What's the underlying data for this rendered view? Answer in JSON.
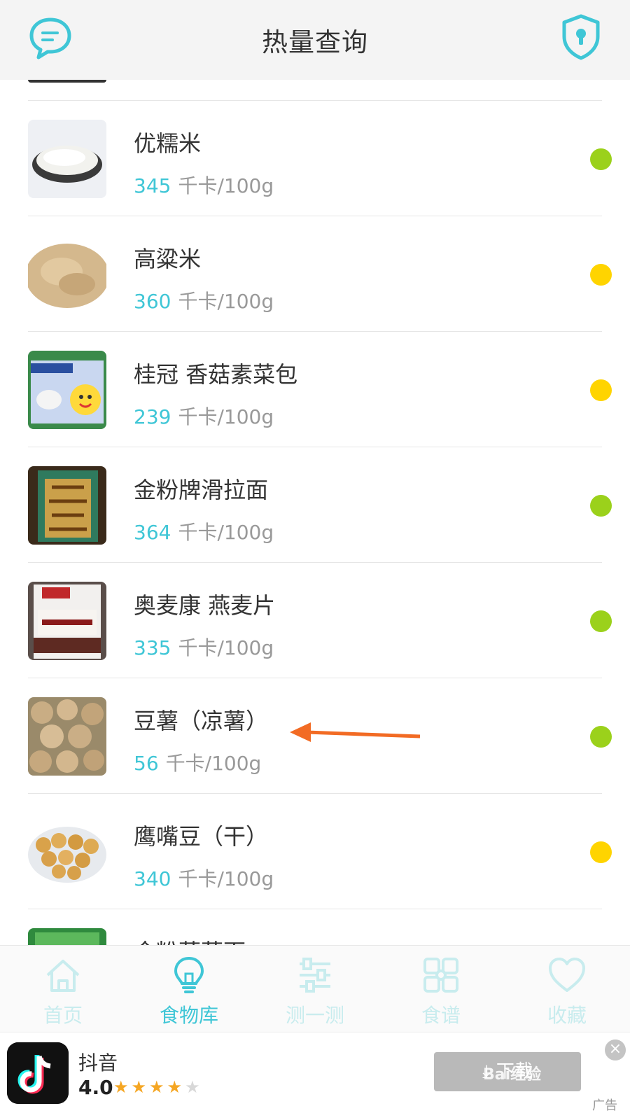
{
  "header": {
    "title": "热量查询"
  },
  "colors": {
    "accent": "#3fc6d6",
    "dot_green": "#9bd11b",
    "dot_yellow": "#ffd400",
    "arrow": "#f26b24"
  },
  "foods": [
    {
      "name": "优糯米",
      "kcal": "345",
      "unit": "千卡/100g",
      "level": "green",
      "thumb": "rice-bowl"
    },
    {
      "name": "高粱米",
      "kcal": "360",
      "unit": "千卡/100g",
      "level": "yellow",
      "thumb": "sorghum"
    },
    {
      "name": "桂冠 香菇素菜包",
      "kcal": "239",
      "unit": "千卡/100g",
      "level": "yellow",
      "thumb": "bun-package"
    },
    {
      "name": "金粉牌滑拉面",
      "kcal": "364",
      "unit": "千卡/100g",
      "level": "green",
      "thumb": "noodle-package"
    },
    {
      "name": "奥麦康 燕麦片",
      "kcal": "335",
      "unit": "千卡/100g",
      "level": "green",
      "thumb": "oatmeal-package"
    },
    {
      "name": "豆薯（凉薯）",
      "kcal": "56",
      "unit": "千卡/100g",
      "level": "green",
      "thumb": "jicama"
    },
    {
      "name": "鹰嘴豆（干）",
      "kcal": "340",
      "unit": "千卡/100g",
      "level": "yellow",
      "thumb": "chickpeas"
    },
    {
      "name": "金粉菠菜面",
      "kcal": "",
      "unit": "",
      "level": "",
      "thumb": "spinach-noodle-package"
    }
  ],
  "tabs": [
    {
      "label": "首页",
      "icon": "home-icon",
      "active": false
    },
    {
      "label": "食物库",
      "icon": "lightbulb-icon",
      "active": true
    },
    {
      "label": "测一测",
      "icon": "sliders-icon",
      "active": false
    },
    {
      "label": "食谱",
      "icon": "grid-icon",
      "active": false
    },
    {
      "label": "收藏",
      "icon": "heart-icon",
      "active": false
    }
  ],
  "ad": {
    "app_name": "抖音",
    "rating": "4.0",
    "stars_filled": 4,
    "stars_total": 5,
    "download_label": "下载",
    "tag": "广告",
    "watermark": "Bai经验"
  }
}
